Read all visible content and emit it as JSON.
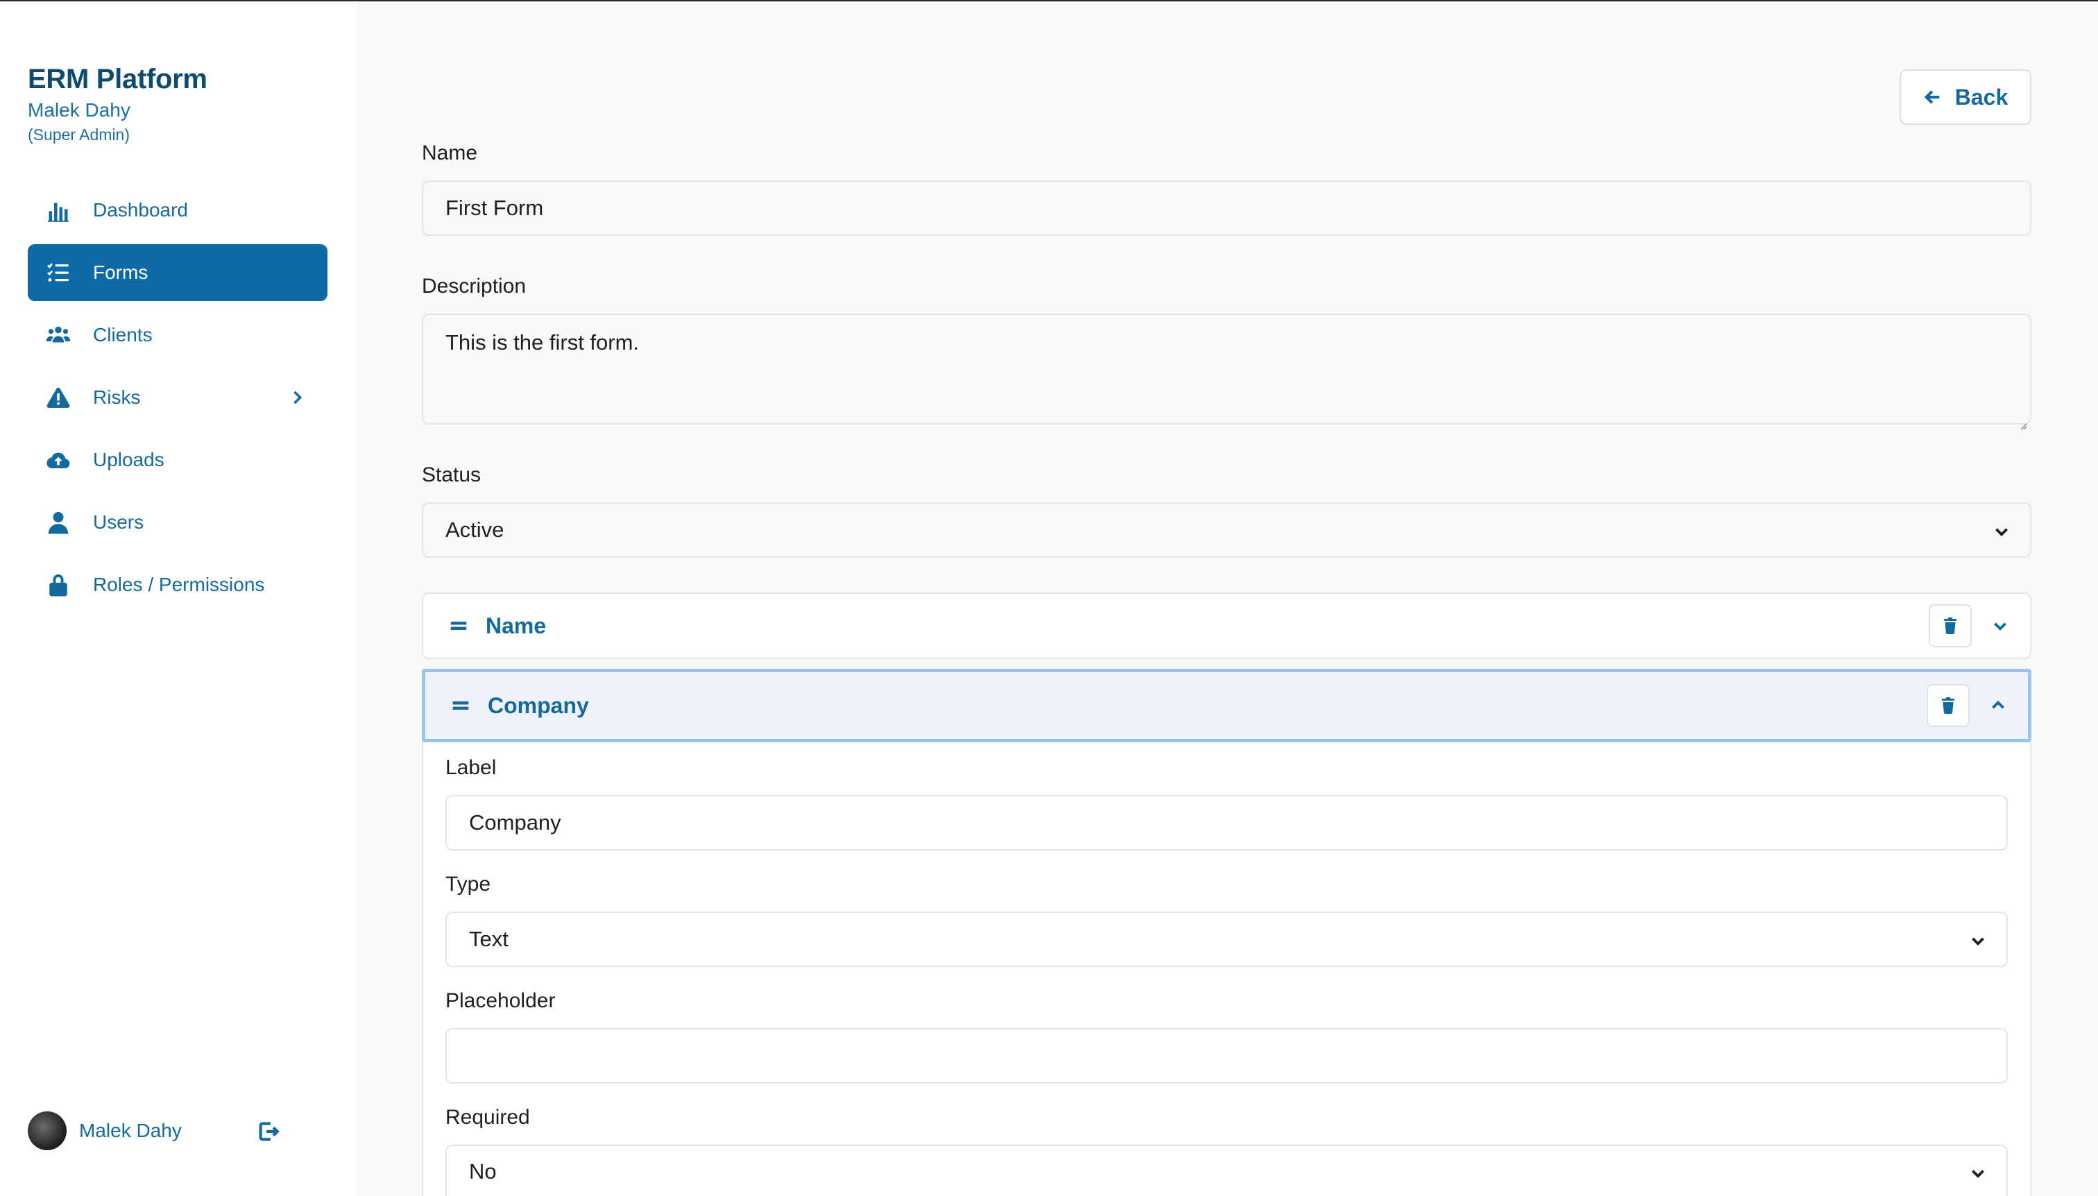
{
  "brand": {
    "title": "ERM Platform",
    "user": "Malek Dahy",
    "role": "(Super Admin)"
  },
  "nav": [
    {
      "label": "Dashboard",
      "icon": "bar-chart-icon",
      "active": false
    },
    {
      "label": "Forms",
      "icon": "checklist-icon",
      "active": true
    },
    {
      "label": "Clients",
      "icon": "users-group-icon",
      "active": false
    },
    {
      "label": "Risks",
      "icon": "warning-icon",
      "active": false,
      "has_submenu": true
    },
    {
      "label": "Uploads",
      "icon": "cloud-upload-icon",
      "active": false
    },
    {
      "label": "Users",
      "icon": "user-icon",
      "active": false
    },
    {
      "label": "Roles / Permissions",
      "icon": "lock-icon",
      "active": false
    }
  ],
  "profile": {
    "name": "Malek Dahy"
  },
  "back_label": "Back",
  "form": {
    "name_label": "Name",
    "name_value": "First Form",
    "description_label": "Description",
    "description_value": "This is the first form.",
    "status_label": "Status",
    "status_value": "Active"
  },
  "fields": [
    {
      "title": "Name",
      "expanded": false
    },
    {
      "title": "Company",
      "expanded": true
    }
  ],
  "field_editor": {
    "label_label": "Label",
    "label_value": "Company",
    "type_label": "Type",
    "type_value": "Text",
    "placeholder_label": "Placeholder",
    "placeholder_value": "",
    "required_label": "Required",
    "required_value": "No"
  },
  "colors": {
    "accent": "#0e6aa6",
    "text_link": "#146a9c",
    "brand": "#0e4a6e",
    "focus_border": "#9cc2e6"
  }
}
